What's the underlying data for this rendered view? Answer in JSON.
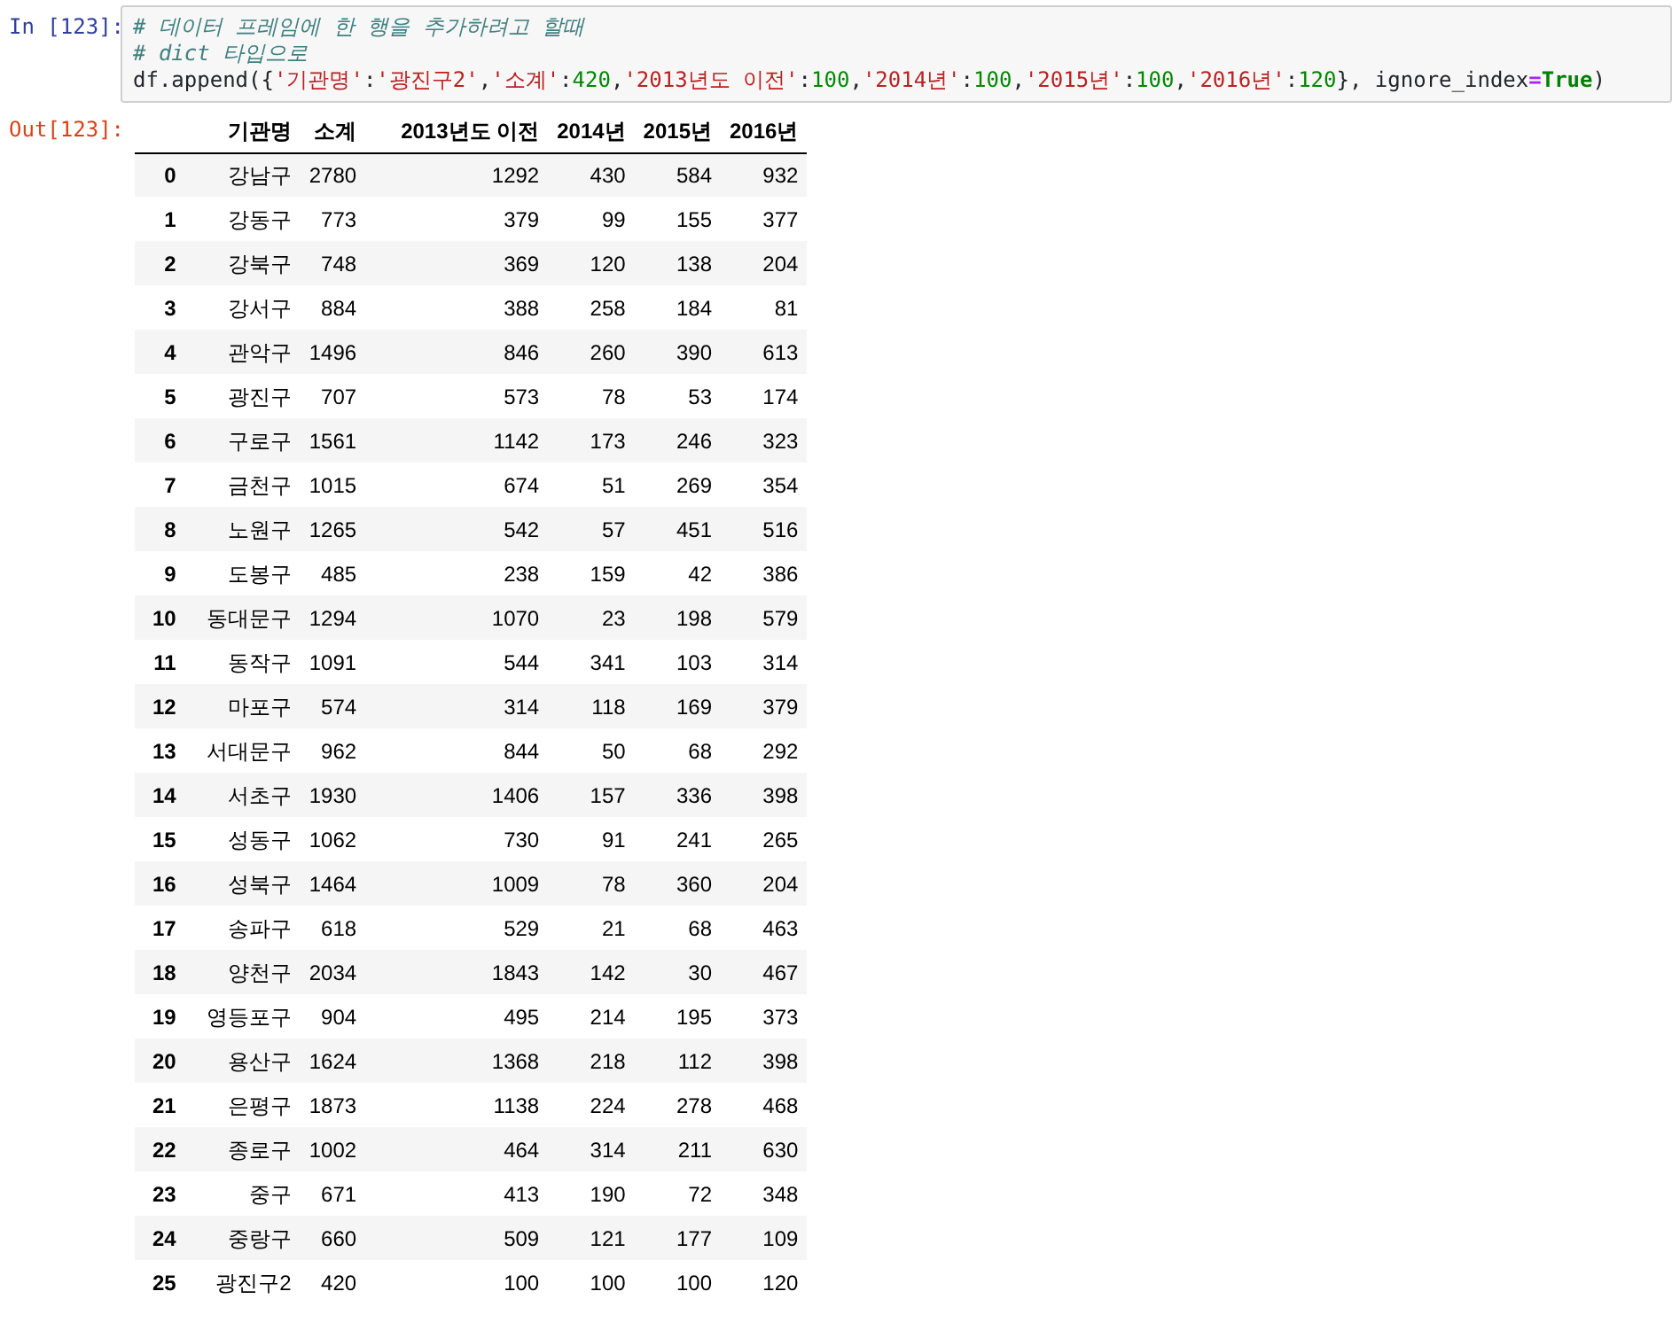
{
  "input_cell": {
    "prompt": "In [123]:",
    "lines": [
      [
        {
          "kind": "comment",
          "text": "# 데이터 프레임에 한 행을 추가하려고 할때"
        }
      ],
      [
        {
          "kind": "comment",
          "text": "# dict 타입으로"
        }
      ],
      [
        {
          "kind": "plain",
          "text": "df.append({"
        },
        {
          "kind": "string",
          "text": "'기관명'"
        },
        {
          "kind": "plain",
          "text": ":"
        },
        {
          "kind": "string",
          "text": "'광진구2'"
        },
        {
          "kind": "plain",
          "text": ","
        },
        {
          "kind": "string",
          "text": "'소계'"
        },
        {
          "kind": "plain",
          "text": ":"
        },
        {
          "kind": "number",
          "text": "420"
        },
        {
          "kind": "plain",
          "text": ","
        },
        {
          "kind": "string",
          "text": "'2013년도 이전'"
        },
        {
          "kind": "plain",
          "text": ":"
        },
        {
          "kind": "number",
          "text": "100"
        },
        {
          "kind": "plain",
          "text": ","
        },
        {
          "kind": "string",
          "text": "'2014년'"
        },
        {
          "kind": "plain",
          "text": ":"
        },
        {
          "kind": "number",
          "text": "100"
        },
        {
          "kind": "plain",
          "text": ","
        },
        {
          "kind": "string",
          "text": "'2015년'"
        },
        {
          "kind": "plain",
          "text": ":"
        },
        {
          "kind": "number",
          "text": "100"
        },
        {
          "kind": "plain",
          "text": ","
        },
        {
          "kind": "string",
          "text": "'2016년'"
        },
        {
          "kind": "plain",
          "text": ":"
        },
        {
          "kind": "number",
          "text": "120"
        },
        {
          "kind": "plain",
          "text": "}, ignore_index"
        },
        {
          "kind": "operator",
          "text": "="
        },
        {
          "kind": "keyword",
          "text": "True"
        },
        {
          "kind": "plain",
          "text": ")"
        }
      ]
    ]
  },
  "output_cell": {
    "prompt": "Out[123]:",
    "table": {
      "columns": [
        "기관명",
        "소계",
        "2013년도 이전",
        "2014년",
        "2015년",
        "2016년"
      ],
      "rows": [
        {
          "index": "0",
          "cells": [
            "강남구",
            "2780",
            "1292",
            "430",
            "584",
            "932"
          ]
        },
        {
          "index": "1",
          "cells": [
            "강동구",
            "773",
            "379",
            "99",
            "155",
            "377"
          ]
        },
        {
          "index": "2",
          "cells": [
            "강북구",
            "748",
            "369",
            "120",
            "138",
            "204"
          ]
        },
        {
          "index": "3",
          "cells": [
            "강서구",
            "884",
            "388",
            "258",
            "184",
            "81"
          ]
        },
        {
          "index": "4",
          "cells": [
            "관악구",
            "1496",
            "846",
            "260",
            "390",
            "613"
          ]
        },
        {
          "index": "5",
          "cells": [
            "광진구",
            "707",
            "573",
            "78",
            "53",
            "174"
          ]
        },
        {
          "index": "6",
          "cells": [
            "구로구",
            "1561",
            "1142",
            "173",
            "246",
            "323"
          ]
        },
        {
          "index": "7",
          "cells": [
            "금천구",
            "1015",
            "674",
            "51",
            "269",
            "354"
          ]
        },
        {
          "index": "8",
          "cells": [
            "노원구",
            "1265",
            "542",
            "57",
            "451",
            "516"
          ]
        },
        {
          "index": "9",
          "cells": [
            "도봉구",
            "485",
            "238",
            "159",
            "42",
            "386"
          ]
        },
        {
          "index": "10",
          "cells": [
            "동대문구",
            "1294",
            "1070",
            "23",
            "198",
            "579"
          ]
        },
        {
          "index": "11",
          "cells": [
            "동작구",
            "1091",
            "544",
            "341",
            "103",
            "314"
          ]
        },
        {
          "index": "12",
          "cells": [
            "마포구",
            "574",
            "314",
            "118",
            "169",
            "379"
          ]
        },
        {
          "index": "13",
          "cells": [
            "서대문구",
            "962",
            "844",
            "50",
            "68",
            "292"
          ]
        },
        {
          "index": "14",
          "cells": [
            "서초구",
            "1930",
            "1406",
            "157",
            "336",
            "398"
          ]
        },
        {
          "index": "15",
          "cells": [
            "성동구",
            "1062",
            "730",
            "91",
            "241",
            "265"
          ]
        },
        {
          "index": "16",
          "cells": [
            "성북구",
            "1464",
            "1009",
            "78",
            "360",
            "204"
          ]
        },
        {
          "index": "17",
          "cells": [
            "송파구",
            "618",
            "529",
            "21",
            "68",
            "463"
          ]
        },
        {
          "index": "18",
          "cells": [
            "양천구",
            "2034",
            "1843",
            "142",
            "30",
            "467"
          ]
        },
        {
          "index": "19",
          "cells": [
            "영등포구",
            "904",
            "495",
            "214",
            "195",
            "373"
          ]
        },
        {
          "index": "20",
          "cells": [
            "용산구",
            "1624",
            "1368",
            "218",
            "112",
            "398"
          ]
        },
        {
          "index": "21",
          "cells": [
            "은평구",
            "1873",
            "1138",
            "224",
            "278",
            "468"
          ]
        },
        {
          "index": "22",
          "cells": [
            "종로구",
            "1002",
            "464",
            "314",
            "211",
            "630"
          ]
        },
        {
          "index": "23",
          "cells": [
            "중구",
            "671",
            "413",
            "190",
            "72",
            "348"
          ]
        },
        {
          "index": "24",
          "cells": [
            "중랑구",
            "660",
            "509",
            "121",
            "177",
            "109"
          ]
        },
        {
          "index": "25",
          "cells": [
            "광진구2",
            "420",
            "100",
            "100",
            "100",
            "120"
          ]
        }
      ]
    }
  }
}
